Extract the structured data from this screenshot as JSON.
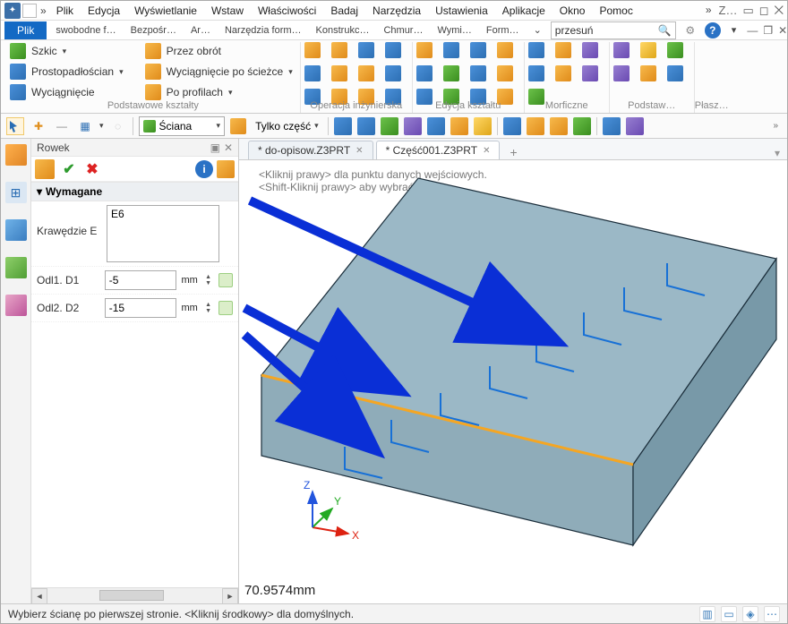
{
  "app": {
    "title": ""
  },
  "menubar": {
    "items": [
      "Plik",
      "Edycja",
      "Wyświetlanie",
      "Wstaw",
      "Właściwości",
      "Badaj",
      "Narzędzia",
      "Ustawienia",
      "Aplikacje",
      "Okno",
      "Pomoc"
    ],
    "overflow": "Z…"
  },
  "tabstrip": {
    "primary": "Plik",
    "secondary": [
      "swobodne f…",
      "Bezpośr…",
      "Ar…",
      "Narzędzia form…",
      "Konstrukc…",
      "Chmur…",
      "Wymi…",
      "Form…"
    ],
    "search": {
      "value": "przesuń",
      "placeholder": ""
    }
  },
  "ribbon": {
    "g1": {
      "label": "Podstawowe kształty",
      "rows": [
        {
          "t": "Szkic",
          "dd": true
        },
        {
          "t": "Prostopadłościan",
          "dd": true
        },
        {
          "t": "Wyciągnięcie"
        }
      ],
      "rows2": [
        {
          "t": "Przez obrót"
        },
        {
          "t": "Wyciągnięcie po ścieżce",
          "dd": true
        },
        {
          "t": "Po profilach",
          "dd": true
        }
      ]
    },
    "g2": {
      "label": "Operacja inżynierska"
    },
    "g3": {
      "label": "Edycja kształtu"
    },
    "g4": {
      "label": "Morficzne"
    },
    "g5": {
      "label": "Podstaw…"
    },
    "g6": {
      "label": "Płasz…"
    }
  },
  "toolbar2": {
    "combo1": "Ściana",
    "combo2": "Tylko część"
  },
  "panel": {
    "title": "Rowek",
    "section": "Wymagane",
    "edges_label": "Krawędzie E",
    "edges_value": "E6",
    "d1_label": "Odl1. D1",
    "d1_value": "-5",
    "d2_label": "Odl2. D2",
    "d2_value": "-15",
    "unit": "mm"
  },
  "doctabs": {
    "t1": "* do-opisow.Z3PRT",
    "t2": "* Część001.Z3PRT"
  },
  "canvas": {
    "hint1": "<Kliknij prawy> dla punktu danych wejściowych.",
    "hint2": "<Shift-Kliknij prawy> aby wybrać filtr.",
    "measurement": "70.9574mm",
    "axes": [
      "X",
      "Y",
      "Z"
    ]
  },
  "statusbar": {
    "text": "Wybierz ścianę po pierwszej stronie.  <Kliknij środkowy> dla domyślnych."
  }
}
